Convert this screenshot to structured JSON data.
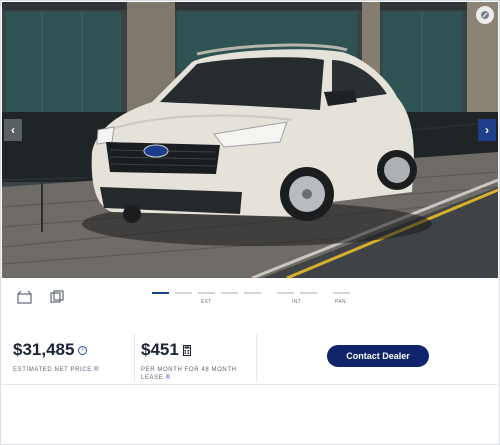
{
  "gallery": {
    "view_labels": [
      "EXT",
      "INT",
      "PAN"
    ]
  },
  "pricing": {
    "net_price": "$31,485",
    "net_price_caption": "ESTIMATED NET PRICE",
    "lease_price": "$451",
    "lease_caption_line1": "PER MONTH FOR 48 MONTH",
    "lease_caption_line2": "LEASE"
  },
  "actions": {
    "contact_label": "Contact Dealer"
  },
  "colors": {
    "primary": "#10246b",
    "accent": "#1d3f8c"
  },
  "icons": {
    "expand": "expand-icon",
    "prev": "chevron-left-icon",
    "next": "chevron-right-icon",
    "exterior_view": "car-view-icon",
    "interior_view": "seat-view-icon",
    "info": "info-icon",
    "calculator": "calculator-icon"
  }
}
